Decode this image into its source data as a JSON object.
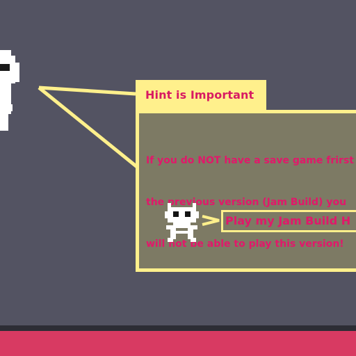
{
  "hint": {
    "title": "Hint is Important",
    "body_lines": [
      "If you do NOT have a save game frirst",
      "the previous version (Jam Build) you",
      "will not be able to play this version!"
    ]
  },
  "play_button": {
    "label": "Play my Jam Build H"
  },
  "colors": {
    "background": "#535362",
    "panel_border": "#fff08c",
    "panel_fill": "#7d7a64",
    "text_magenta": "#e1186a",
    "bottom_bar": "#d83a62",
    "bottom_shadow": "#2d2d35"
  },
  "icons": {
    "ghost": "ghost-icon",
    "robot": "robot-icon",
    "arrow": "arrow-right-icon"
  }
}
